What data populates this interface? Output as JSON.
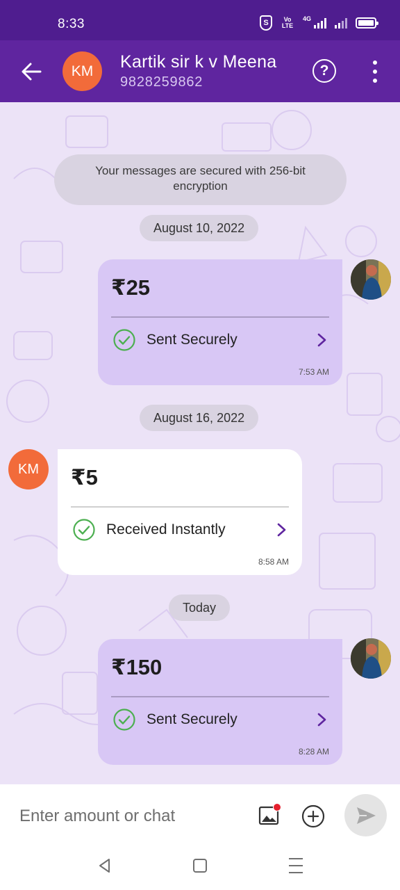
{
  "status_bar": {
    "time": "8:33",
    "network_label": "4G",
    "volte": "Vo LTE"
  },
  "header": {
    "avatar_initials": "KM",
    "contact_name": "Kartik sir k v Meena",
    "contact_phone": "9828259862",
    "icons": [
      "back-arrow-icon",
      "help-icon",
      "more-options-icon"
    ]
  },
  "chat": {
    "encryption_notice": "Your messages are secured with 256-bit encryption",
    "dates": [
      "August 10, 2022",
      "August 16, 2022",
      "Today"
    ],
    "messages": [
      {
        "direction": "sent",
        "amount": "₹25",
        "status": "Sent Securely",
        "time": "7:53 AM"
      },
      {
        "direction": "received",
        "sender_initials": "KM",
        "amount": "₹5",
        "status": "Received Instantly",
        "time": "8:58 AM"
      },
      {
        "direction": "sent",
        "amount": "₹150",
        "status": "Sent Securely",
        "time": "8:28 AM"
      }
    ]
  },
  "input": {
    "placeholder": "Enter amount or chat"
  },
  "colors": {
    "status_bar": "#4f1d8f",
    "app_bar": "#5f259f",
    "chat_background": "#ece3f7",
    "sent_bubble": "#d8c7f5",
    "received_bubble": "#ffffff",
    "avatar": "#f26b3a",
    "success_check": "#4caf50",
    "chevron": "#5f259f"
  }
}
